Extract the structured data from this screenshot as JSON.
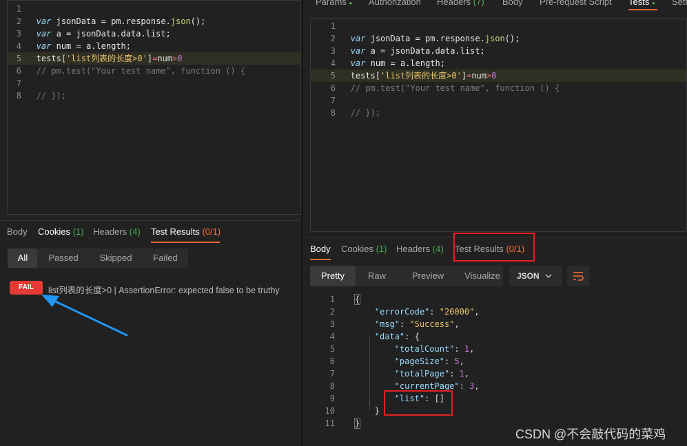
{
  "left": {
    "code_lines": [
      "1",
      "2",
      "3",
      "4",
      "5",
      "6",
      "7",
      "8"
    ],
    "code": {
      "l2": [
        "var",
        " jsonData = pm.response.",
        "json",
        "();"
      ],
      "l3": [
        "var",
        " a = jsonData.data.list;"
      ],
      "l4": [
        "var",
        " num = a.length;"
      ],
      "l5": [
        "tests[",
        "'list列表的长度>0'",
        "]",
        "=",
        "num",
        ">",
        "0"
      ],
      "l6": "// pm.test(\"Your test name\", function () {",
      "l8": "// });"
    },
    "response_tabs": [
      {
        "label": "Body",
        "count": ""
      },
      {
        "label": "Cookies",
        "count": "(1)"
      },
      {
        "label": "Headers",
        "count": "(4)"
      },
      {
        "label": "Test Results",
        "count": "(0/1)"
      }
    ],
    "filters": [
      "All",
      "Passed",
      "Skipped",
      "Failed"
    ],
    "result": {
      "badge": "FAIL",
      "message": "list列表的长度>0 | AssertionError: expected false to be truthy"
    }
  },
  "right": {
    "request_tabs": [
      {
        "label": "Params",
        "dot": "●"
      },
      {
        "label": "Authorization",
        "dot": ""
      },
      {
        "label": "Headers",
        "count": "(7)"
      },
      {
        "label": "Body",
        "dot": ""
      },
      {
        "label": "Pre-request Script",
        "dot": ""
      },
      {
        "label": "Tests",
        "dot": "●"
      },
      {
        "label": "Setti",
        "dot": ""
      }
    ],
    "code_lines": [
      "1",
      "2",
      "3",
      "4",
      "5",
      "6",
      "7",
      "8"
    ],
    "response_tabs": [
      {
        "label": "Body",
        "count": ""
      },
      {
        "label": "Cookies",
        "count": "(1)"
      },
      {
        "label": "Headers",
        "count": "(4)"
      },
      {
        "label": "Test Results",
        "count": "(0/1)"
      }
    ],
    "view_modes": [
      "Pretty",
      "Raw",
      "Preview",
      "Visualize"
    ],
    "format": "JSON",
    "json_lines": [
      "1",
      "2",
      "3",
      "4",
      "5",
      "6",
      "7",
      "8",
      "9",
      "10",
      "11"
    ],
    "json": {
      "errorCode_key": "\"errorCode\"",
      "errorCode_val": "\"20000\"",
      "msg_key": "\"msg\"",
      "msg_val": "\"Success\"",
      "data_key": "\"data\"",
      "totalCount_key": "\"totalCount\"",
      "totalCount_val": "1",
      "pageSize_key": "\"pageSize\"",
      "pageSize_val": "5",
      "totalPage_key": "\"totalPage\"",
      "totalPage_val": "1",
      "currentPage_key": "\"currentPage\"",
      "currentPage_val": "3",
      "list_key": "\"list\"",
      "list_val": "[]"
    }
  },
  "watermark": "CSDN @不会敲代码的菜鸡",
  "colors": {
    "accent": "#ff6c37",
    "fail": "#e53935",
    "annotation_red": "#e02020",
    "arrow": "#2196f3"
  }
}
